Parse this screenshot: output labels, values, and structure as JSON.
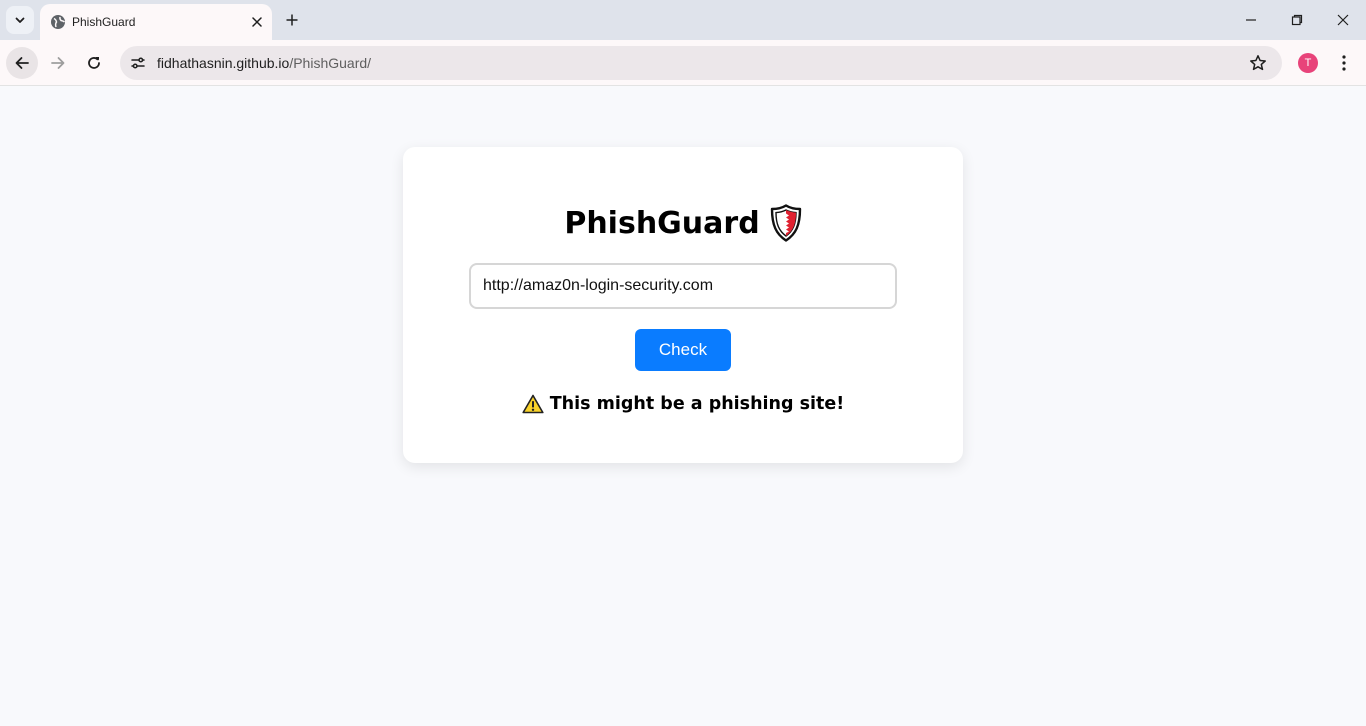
{
  "browser": {
    "tab": {
      "title": "PhishGuard",
      "favicon": "globe-icon"
    },
    "url": {
      "host": "fidhathasnin.github.io",
      "path": "/PhishGuard/"
    },
    "profile_initial": "T",
    "colors": {
      "profile": "#e8437a",
      "tabstrip": "#dfe3eb"
    }
  },
  "app": {
    "title": "PhishGuard",
    "title_icon": "shield-icon",
    "input": {
      "value": "http://amaz0n-login-security.com",
      "placeholder": ""
    },
    "check_label": "Check",
    "result": {
      "icon": "warning-icon",
      "text": "This might be a phishing site!"
    },
    "colors": {
      "button": "#0a7cff",
      "shield_fill": "#e02231",
      "warning": "#f8d22a"
    }
  }
}
